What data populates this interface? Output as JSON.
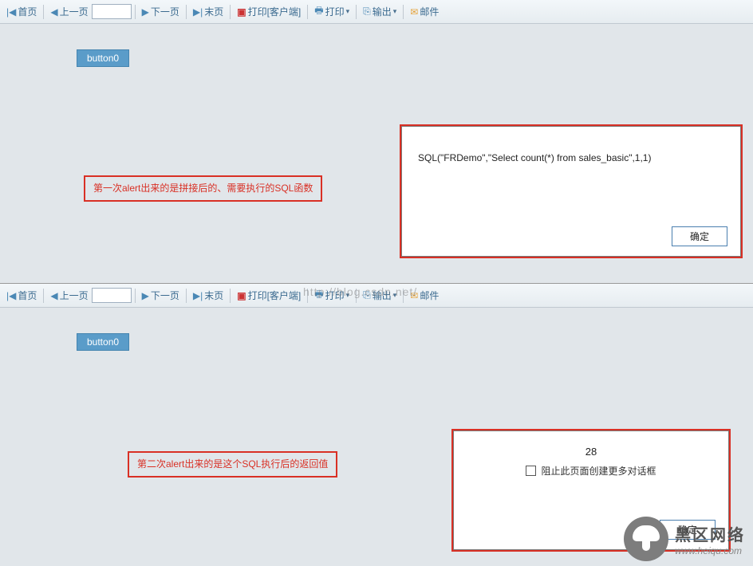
{
  "toolbar": {
    "first_page": "首页",
    "prev_page": "上一页",
    "next_page": "下一页",
    "last_page": "末页",
    "print_client": "打印[客户端]",
    "print": "打印",
    "export": "输出",
    "mail": "邮件",
    "page_value": ""
  },
  "button0_label": "button0",
  "annotations": {
    "first": "第一次alert出来的是拼接后的、需要执行的SQL函数",
    "second": "第二次alert出来的是这个SQL执行后的返回值"
  },
  "dialogs": {
    "first": {
      "message": "SQL(\"FRDemo\",\"Select count(*) from sales_basic\",1,1)",
      "ok": "确定"
    },
    "second": {
      "value": "28",
      "checkbox_label": "阻止此页面创建更多对话框",
      "ok": "确定"
    }
  },
  "watermark": "http://blog.csdn.net/",
  "brand": {
    "title": "黑区网络",
    "url": "www.heiqu.com"
  }
}
